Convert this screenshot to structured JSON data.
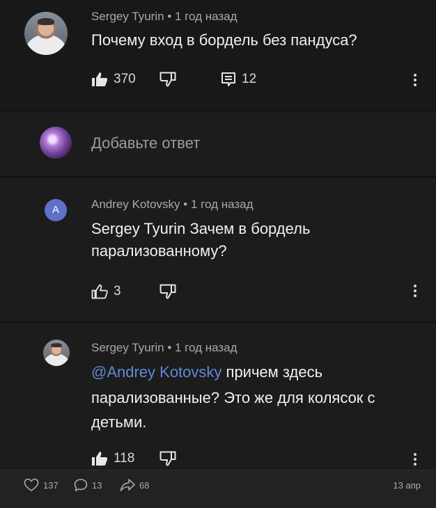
{
  "comments": [
    {
      "author": "Sergey Tyurin",
      "separator": "•",
      "time": "1 год назад",
      "text": "Почему вход в бордель без пандуса?",
      "likes": "370",
      "replies": "12"
    },
    {
      "reply_placeholder": "Добавьте ответ"
    },
    {
      "avatar_letter": "A",
      "author": "Andrey Kotovsky",
      "separator": "•",
      "time": "1 год назад",
      "text_line1": "Sergey Tyurin Зачем в бордель",
      "text_line2": "парализованному?",
      "likes": "3"
    },
    {
      "author": "Sergey Tyurin",
      "separator": "•",
      "time": "1 год назад",
      "mention": "@Andrey Kotovsky",
      "text_line1_rest": " причем здесь",
      "text_line2": "парализованные? Это же для колясок с",
      "text_line3": "детьми.",
      "likes": "118"
    }
  ],
  "footer": {
    "likes": "137",
    "comments": "13",
    "shares": "68",
    "date": "13 апр"
  },
  "colors": {
    "mention": "#5f8ad8",
    "avatar_letter_bg": "#5e71c7"
  },
  "icons": [
    "like-filled-icon",
    "dislike-icon",
    "reply-icon",
    "more-vert-icon",
    "like-outline-icon",
    "heart-icon",
    "comment-bubble-icon",
    "share-arrow-icon"
  ]
}
